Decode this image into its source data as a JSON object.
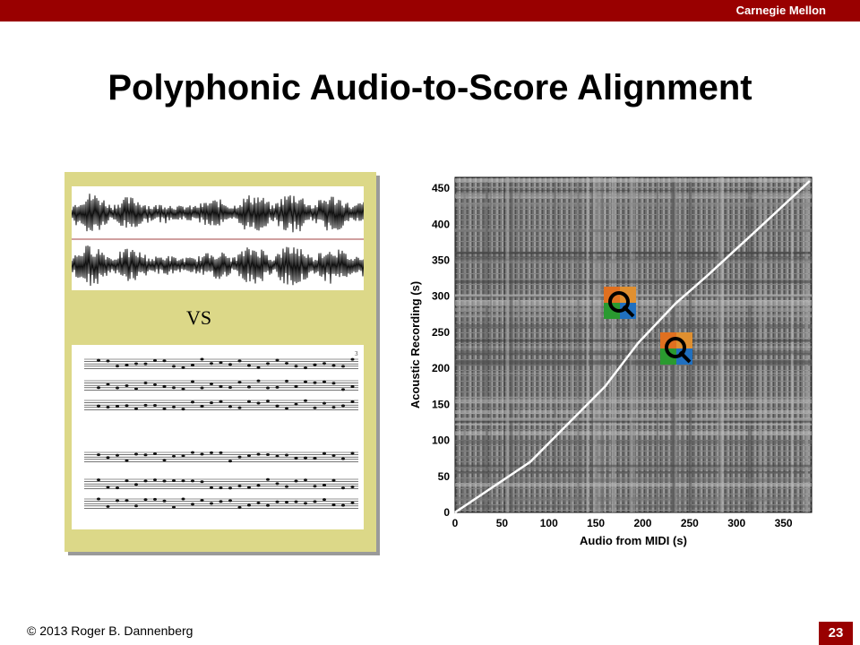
{
  "header": {
    "brand": "Carnegie Mellon"
  },
  "slide": {
    "title": "Polyphonic Audio-to-Score Alignment"
  },
  "left_panel": {
    "vs_label": "VS",
    "score_page_number": "3"
  },
  "footer": {
    "copyright": "© 2013 Roger B. Dannenberg",
    "page_number": "23"
  },
  "colors": {
    "brand_red": "#990000",
    "panel_yellow": "#dcd888"
  },
  "chart_data": {
    "type": "heatmap",
    "xlabel": "Audio from MIDI (s)",
    "ylabel": "Acoustic Recording (s)",
    "x_ticks": [
      "0",
      "50",
      "100",
      "150",
      "200",
      "250",
      "300",
      "350"
    ],
    "y_ticks": [
      "0",
      "50",
      "100",
      "150",
      "200",
      "250",
      "300",
      "350",
      "400",
      "450"
    ],
    "xlim": [
      0,
      380
    ],
    "ylim": [
      0,
      465
    ],
    "alignment_path": [
      [
        0,
        0
      ],
      [
        80,
        70
      ],
      [
        160,
        175
      ],
      [
        195,
        235
      ],
      [
        235,
        290
      ],
      [
        270,
        330
      ],
      [
        320,
        390
      ],
      [
        378,
        460
      ]
    ],
    "icons": [
      "quicktime-icon",
      "quicktime-icon"
    ]
  }
}
